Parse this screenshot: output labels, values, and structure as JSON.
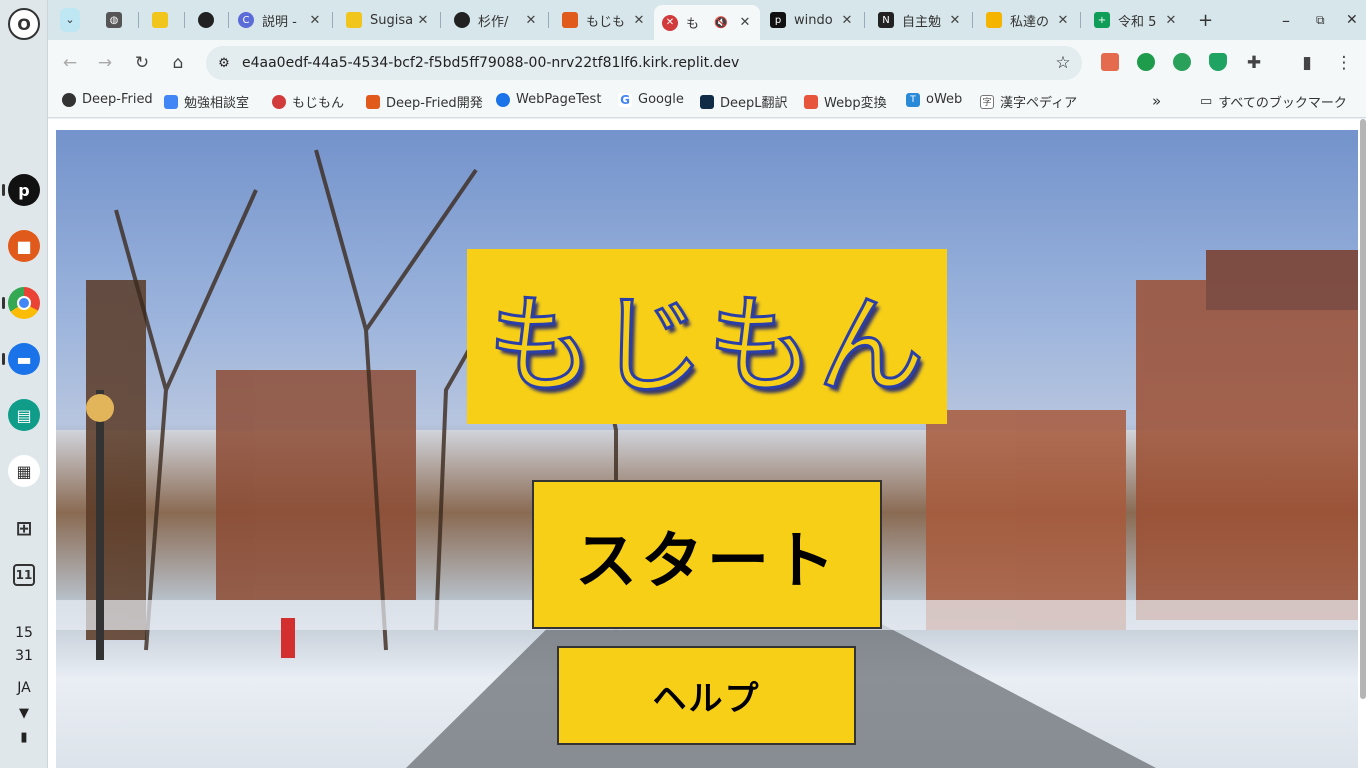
{
  "shelf": {
    "launcher_glyph": "O",
    "apps": [
      {
        "name": "pixiv",
        "glyph": "p",
        "color": "#111111"
      },
      {
        "name": "deep-fried",
        "glyph": "■",
        "color": "#e05a1c"
      },
      {
        "name": "chrome",
        "glyph": "",
        "color": "#4285f4"
      },
      {
        "name": "files",
        "glyph": "▬",
        "color": "#1a73e8"
      },
      {
        "name": "classroom",
        "glyph": "▤",
        "color": "#0f9d8a"
      },
      {
        "name": "qr",
        "glyph": "▦",
        "color": "#555555"
      },
      {
        "name": "screenshot",
        "glyph": "⊞",
        "color": "#333333"
      },
      {
        "name": "calendar",
        "glyph": "11",
        "color": "#333333"
      }
    ],
    "clock_hour": "15",
    "clock_minute": "31",
    "ime": "JA"
  },
  "tabs": [
    {
      "title": "",
      "favicon": "globe",
      "color": "#555555"
    },
    {
      "title": "",
      "favicon": "emoji",
      "color": "#f2c51d"
    },
    {
      "title": "",
      "favicon": "github",
      "color": "#222222"
    },
    {
      "title": "説明 -",
      "favicon": "c",
      "color": "#5b6bd8"
    },
    {
      "title": "Sugisa",
      "favicon": "emoji",
      "color": "#f2c51d"
    },
    {
      "title": "杉作/",
      "favicon": "github",
      "color": "#222222"
    },
    {
      "title": "もじも",
      "favicon": "deep-fried",
      "color": "#e05a1c"
    },
    {
      "title": "も",
      "favicon": "mojimon",
      "color": "#d23b3b",
      "active": true
    },
    {
      "title": "windo",
      "favicon": "p",
      "color": "#111111"
    },
    {
      "title": "自主勉",
      "favicon": "notion",
      "color": "#222222"
    },
    {
      "title": "私達の",
      "favicon": "slides",
      "color": "#f4b400"
    },
    {
      "title": "令和 5",
      "favicon": "sheets",
      "color": "#0f9d58"
    }
  ],
  "url": "e4aa0edf-44a5-4534-bcf2-f5bd5ff79088-00-nrv22tf81lf6.kirk.replit.dev",
  "bookmarks": [
    {
      "label": "Deep-Fried",
      "color": "#333333"
    },
    {
      "label": "勉強相談室",
      "color": "#4285f4"
    },
    {
      "label": "もじもん",
      "color": "#d23b3b"
    },
    {
      "label": "Deep-Fried開発",
      "color": "#e05a1c"
    },
    {
      "label": "WebPageTest",
      "color": "#1a73e8"
    },
    {
      "label": "Google",
      "color": "#4285f4"
    },
    {
      "label": "DeepL翻訳",
      "color": "#0f2b46"
    },
    {
      "label": "Webp変換",
      "color": "#e8553d"
    },
    {
      "label": "oWeb",
      "color": "#2b8ad8"
    },
    {
      "label": "漢字ペディア",
      "color": "#555555"
    }
  ],
  "all_bookmarks": "すべてのブックマーク",
  "page": {
    "title": "もじもん",
    "start_label": "スタート",
    "help_label": "ヘルプ",
    "accent": "#f7cf16",
    "title_stroke": "#2b3fa8"
  }
}
